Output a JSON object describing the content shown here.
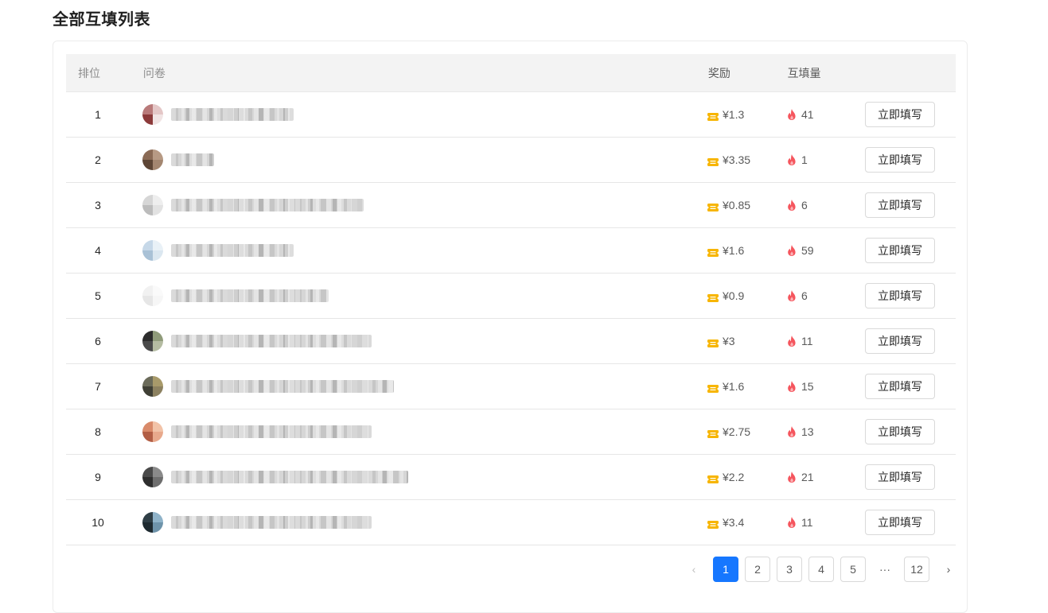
{
  "page": {
    "title": "全部互填列表"
  },
  "table": {
    "columns": {
      "rank": "排位",
      "survey": "问卷",
      "reward": "奖励",
      "count": "互填量"
    },
    "action_label": "立即填写",
    "rows": [
      {
        "rank": "1",
        "reward": "¥1.3",
        "count": "41",
        "avatar": [
          "#b97a7a",
          "#e4c7c7",
          "#8c3a3a",
          "#f1e4e4"
        ],
        "title_width": 154
      },
      {
        "rank": "2",
        "reward": "¥3.35",
        "count": "1",
        "avatar": [
          "#8a6a55",
          "#b79a84",
          "#5d4535",
          "#a38670"
        ],
        "title_width": 54
      },
      {
        "rank": "3",
        "reward": "¥0.85",
        "count": "6",
        "avatar": [
          "#d6d6d6",
          "#eeeeee",
          "#bcbcbc",
          "#e2e2e2"
        ],
        "title_width": 242
      },
      {
        "rank": "4",
        "reward": "¥1.6",
        "count": "59",
        "avatar": [
          "#c6d8e8",
          "#e9f1f7",
          "#a9c1d6",
          "#dbe7f0"
        ],
        "title_width": 154
      },
      {
        "rank": "5",
        "reward": "¥0.9",
        "count": "6",
        "avatar": [
          "#f1f1f1",
          "#fafafa",
          "#e6e6e6",
          "#f6f6f6"
        ],
        "title_width": 198
      },
      {
        "rank": "6",
        "reward": "¥3",
        "count": "11",
        "avatar": [
          "#2c2c2c",
          "#8f9b7a",
          "#4a4a4a",
          "#b5bca2"
        ],
        "title_width": 252
      },
      {
        "rank": "7",
        "reward": "¥1.6",
        "count": "15",
        "avatar": [
          "#6b6b5a",
          "#a89a6a",
          "#3f3f35",
          "#8c8160"
        ],
        "title_width": 280
      },
      {
        "rank": "8",
        "reward": "¥2.75",
        "count": "13",
        "avatar": [
          "#d98a6a",
          "#f2c3a8",
          "#b25e45",
          "#e8a98c"
        ],
        "title_width": 252
      },
      {
        "rank": "9",
        "reward": "¥2.2",
        "count": "21",
        "avatar": [
          "#4a4a4a",
          "#8a8a8a",
          "#2e2e2e",
          "#6e6e6e"
        ],
        "title_width": 298
      },
      {
        "rank": "10",
        "reward": "¥3.4",
        "count": "11",
        "avatar": [
          "#2f3e46",
          "#8fb3c9",
          "#1e2a30",
          "#6e93aa"
        ],
        "title_width": 252
      }
    ]
  },
  "pagination": {
    "prev": "‹",
    "next": "›",
    "pages": [
      "1",
      "2",
      "3",
      "4",
      "5"
    ],
    "ellipsis": "···",
    "last": "12",
    "current": "1"
  },
  "colors": {
    "accent": "#1677ff",
    "ticket": "#f7b500",
    "fire": "#f5555d"
  },
  "icons": {
    "reward": "ticket-icon",
    "count": "fire-icon"
  }
}
